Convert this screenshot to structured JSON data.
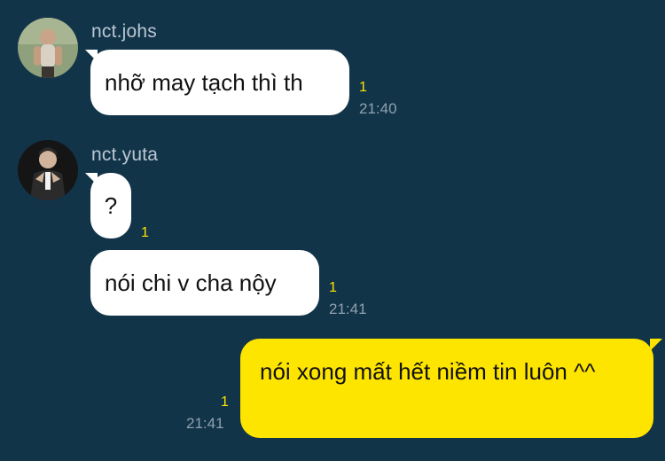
{
  "chat": {
    "colors": {
      "background": "#123449",
      "incoming_bubble": "#ffffff",
      "outgoing_bubble": "#fee500",
      "unread": "#fee500",
      "timestamp": "#8fa1ad",
      "sender": "#b9c7d2"
    },
    "groups": [
      {
        "sender": "nct.johs",
        "avatar_icon": "profile-photo-icon",
        "messages": [
          {
            "text": "nhỡ may tạch thì th",
            "unread": "1",
            "time": "21:40"
          }
        ]
      },
      {
        "sender": "nct.yuta",
        "avatar_icon": "profile-photo-icon",
        "messages": [
          {
            "text": "?",
            "unread": "1"
          },
          {
            "text": "nói chi v cha nộy",
            "unread": "1",
            "time": "21:41"
          }
        ]
      }
    ],
    "outgoing": [
      {
        "text": "nói xong mất hết niềm tin luôn ^^",
        "unread": "1",
        "time": "21:41"
      }
    ]
  }
}
